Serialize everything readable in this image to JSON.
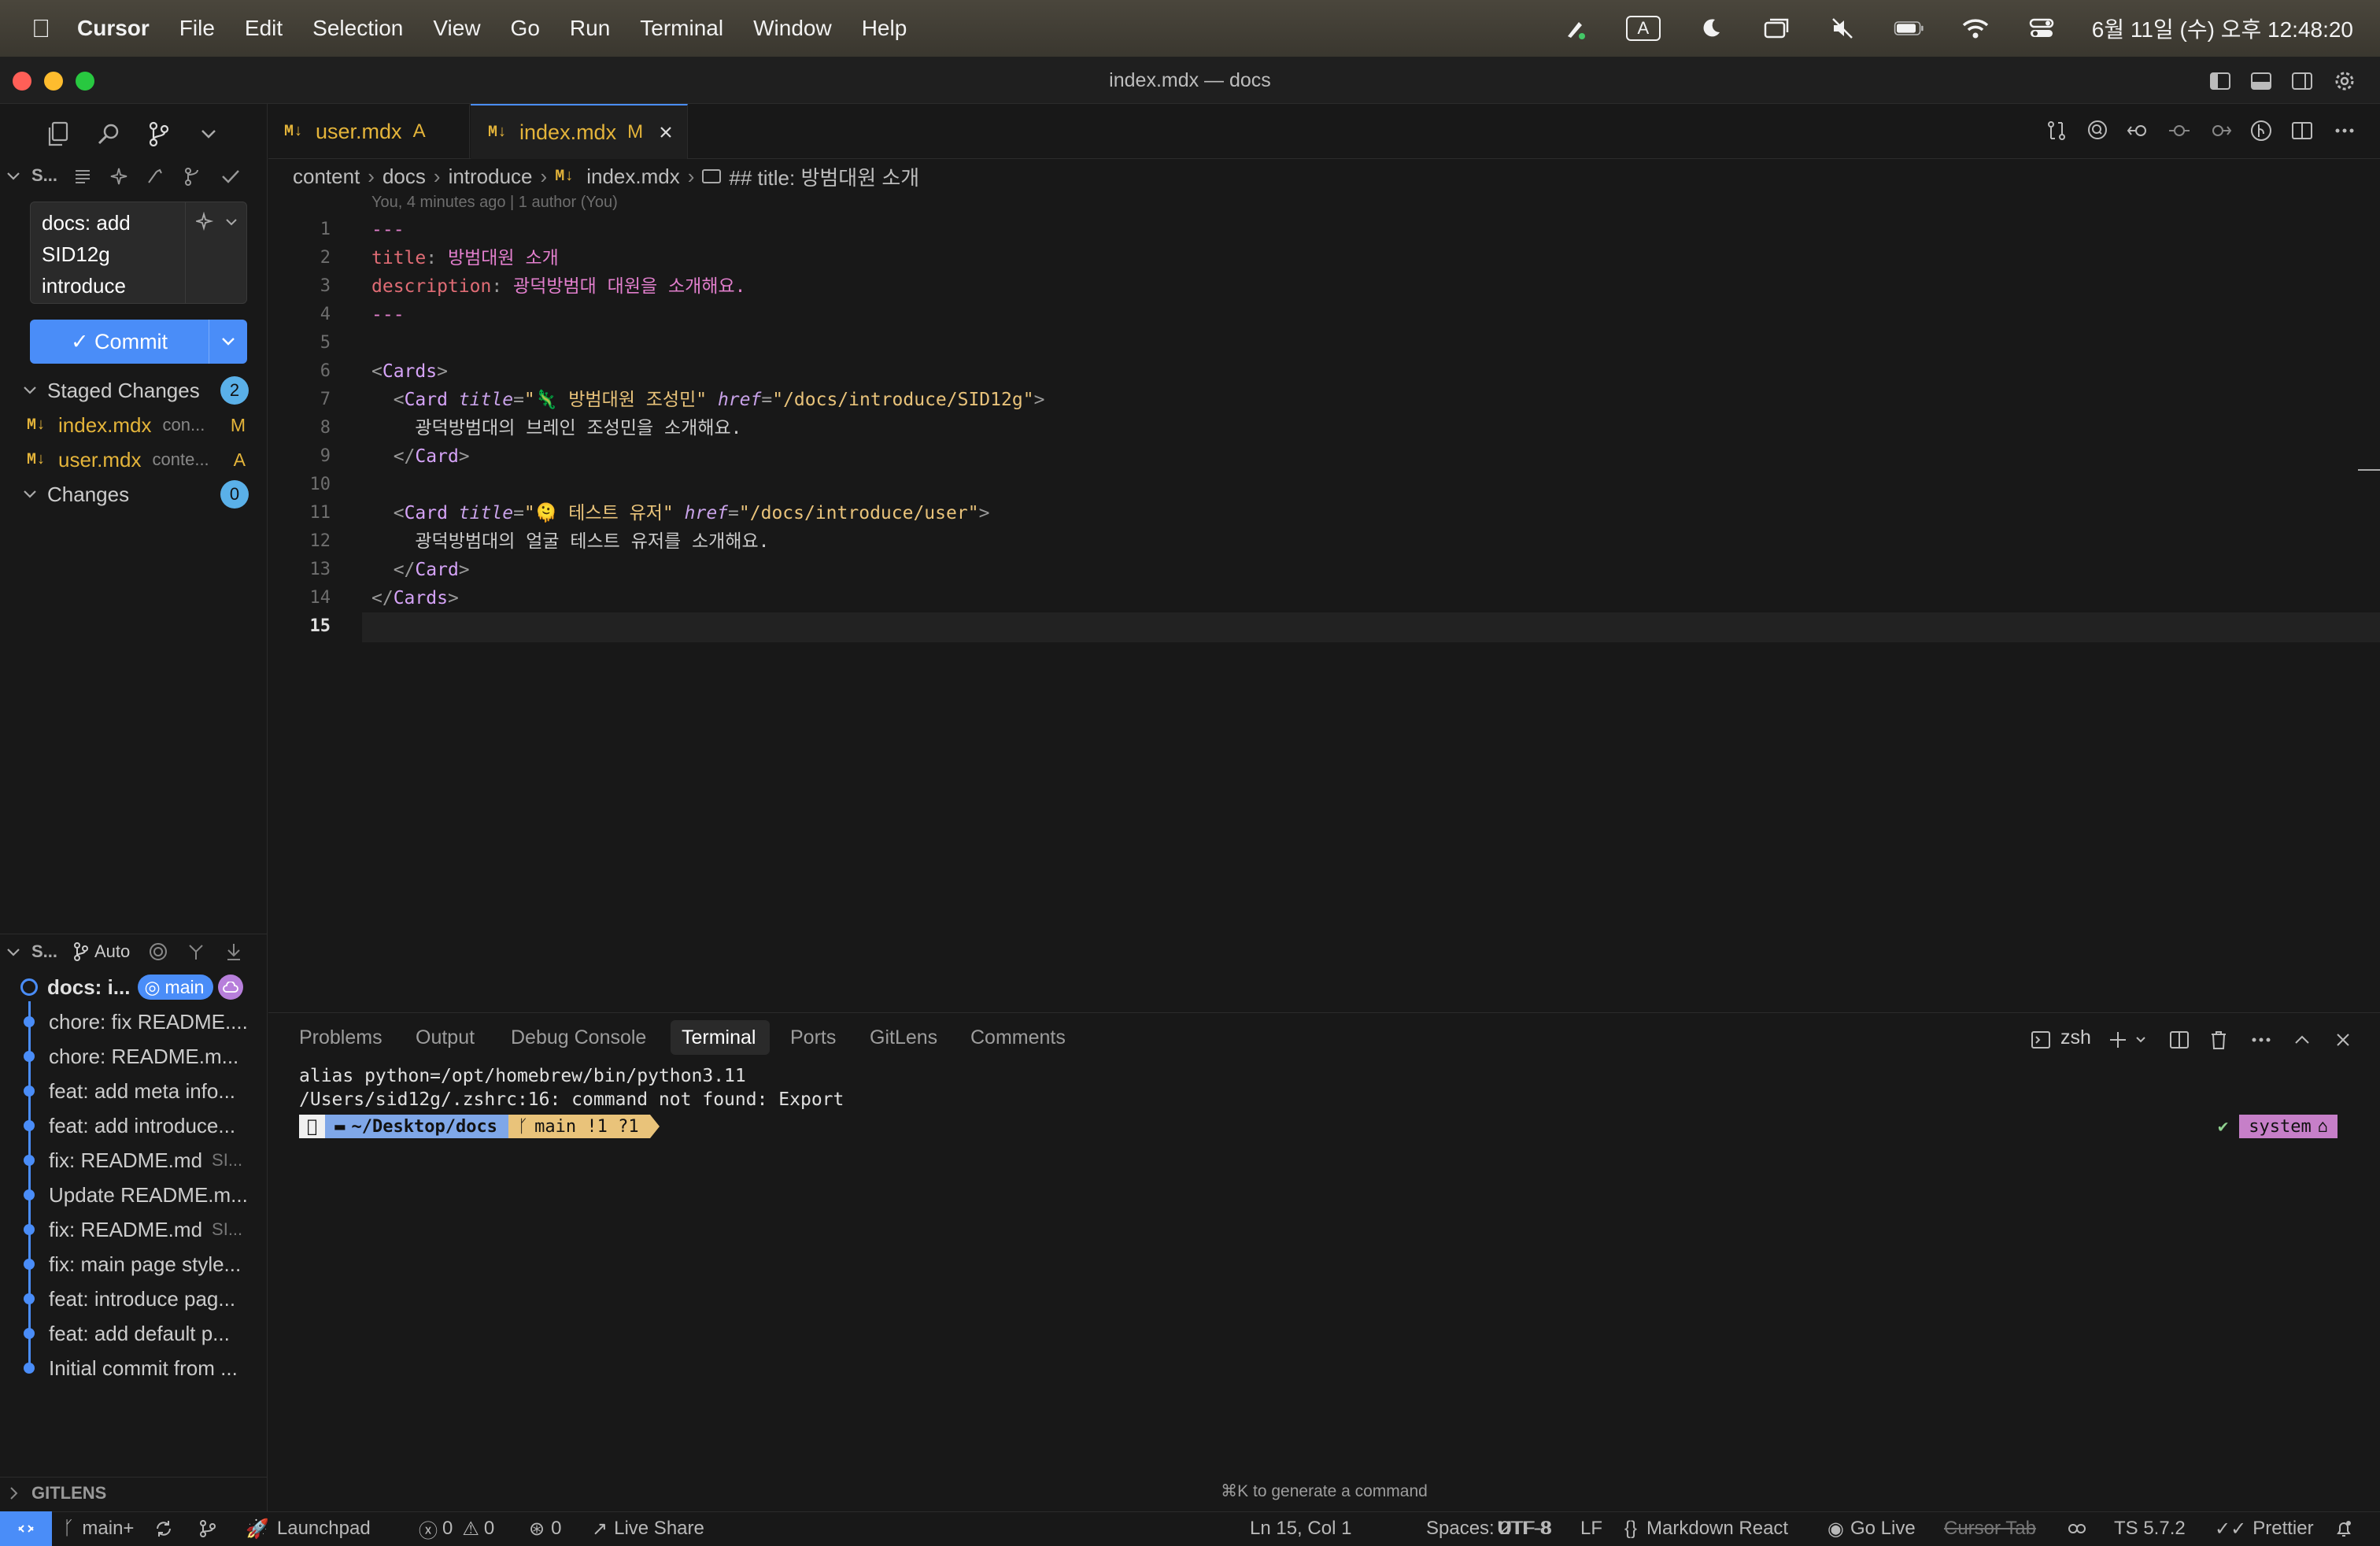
{
  "menubar": {
    "app": "Cursor",
    "items": [
      "File",
      "Edit",
      "Selection",
      "View",
      "Go",
      "Run",
      "Terminal",
      "Window",
      "Help"
    ],
    "clock": "6월 11일 (수) 오후 12:48:20",
    "input_source": "A"
  },
  "window": {
    "title": "index.mdx — docs"
  },
  "scm": {
    "section_title": "S...",
    "commit_message": "docs: add\nSID12g\nintroduce",
    "commit_label": "✓ Commit",
    "staged_label": "Staged Changes",
    "staged_count": "2",
    "changes_label": "Changes",
    "changes_count": "0",
    "staged_files": [
      {
        "name": "index.mdx",
        "path": "con...",
        "status": "M"
      },
      {
        "name": "user.mdx",
        "path": "conte...",
        "status": "A"
      }
    ]
  },
  "graph": {
    "section_title": "S...",
    "auto_label": "Auto",
    "head_commit": "docs: i...",
    "branch": "main",
    "commits": [
      "chore: fix README....",
      "chore: README.m...",
      "feat: add meta info...",
      "feat: add introduce...",
      "fix: README.md",
      "Update README.m...",
      "fix: README.md",
      "fix: main page style...",
      "feat: introduce pag...",
      "feat: add default p...",
      "Initial commit from ..."
    ],
    "commit_suffix": "SI...",
    "gitlens_label": "GITLENS"
  },
  "tabs": [
    {
      "name": "user.mdx",
      "status": "A"
    },
    {
      "name": "index.mdx",
      "status": "M"
    }
  ],
  "breadcrumb": [
    "content",
    "docs",
    "introduce",
    "index.mdx",
    "## title: 방범대원 소개"
  ],
  "blame": "You, 4 minutes ago | 1 author (You)",
  "editor": {
    "line_numbers": [
      "1",
      "2",
      "3",
      "4",
      "5",
      "6",
      "7",
      "8",
      "9",
      "10",
      "11",
      "12",
      "13",
      "14",
      "15"
    ],
    "current_line": "15",
    "l1": "---",
    "l2_key": "title",
    "l2_val": "방범대원 소개",
    "l3_key": "description",
    "l3_val": "광덕방범대 대원을 소개해요.",
    "l4": "---",
    "cards_open": "Cards",
    "card": "Card",
    "attr_title": "title",
    "attr_href": "href",
    "card1_title": "🦎 방범대원 조성민",
    "card1_href": "/docs/introduce/SID12g",
    "card1_body": "광덕방범대의 브레인 조성민을 소개해요.",
    "card2_title": "🫠 테스트 유저",
    "card2_href": "/docs/introduce/user",
    "card2_body": "광덕방범대의 얼굴 테스트 유저를 소개해요."
  },
  "panel": {
    "tabs": [
      "Problems",
      "Output",
      "Debug Console",
      "Terminal",
      "Ports",
      "GitLens",
      "Comments"
    ],
    "active_tab": "Terminal",
    "shell": "zsh",
    "lines": [
      "alias python=/opt/homebrew/bin/python3.11",
      "/Users/sid12g/.zshrc:16: command not found: Export"
    ],
    "prompt_path": "~/Desktop/docs",
    "prompt_git": "main !1 ?1",
    "prompt_right": "system",
    "hint": "⌘K to generate a command"
  },
  "status": {
    "branch": "main+",
    "launchpad": "Launchpad",
    "errors": "0",
    "warnings": "0",
    "ports": "0",
    "live_share": "Live Share",
    "position": "Ln 15, Col 1",
    "spaces": "Spaces: 2",
    "encoding": "UTF-8",
    "eol": "LF",
    "language": "Markdown React",
    "go_live": "Go Live",
    "cursor_tab": "Cursor Tab",
    "ts": "TS 5.7.2",
    "prettier": "Prettier"
  },
  "colors": {
    "accent": "#4a8df8",
    "modified": "#e4b43a",
    "tag": "#d5a3f7",
    "string": "#e9c37a"
  }
}
